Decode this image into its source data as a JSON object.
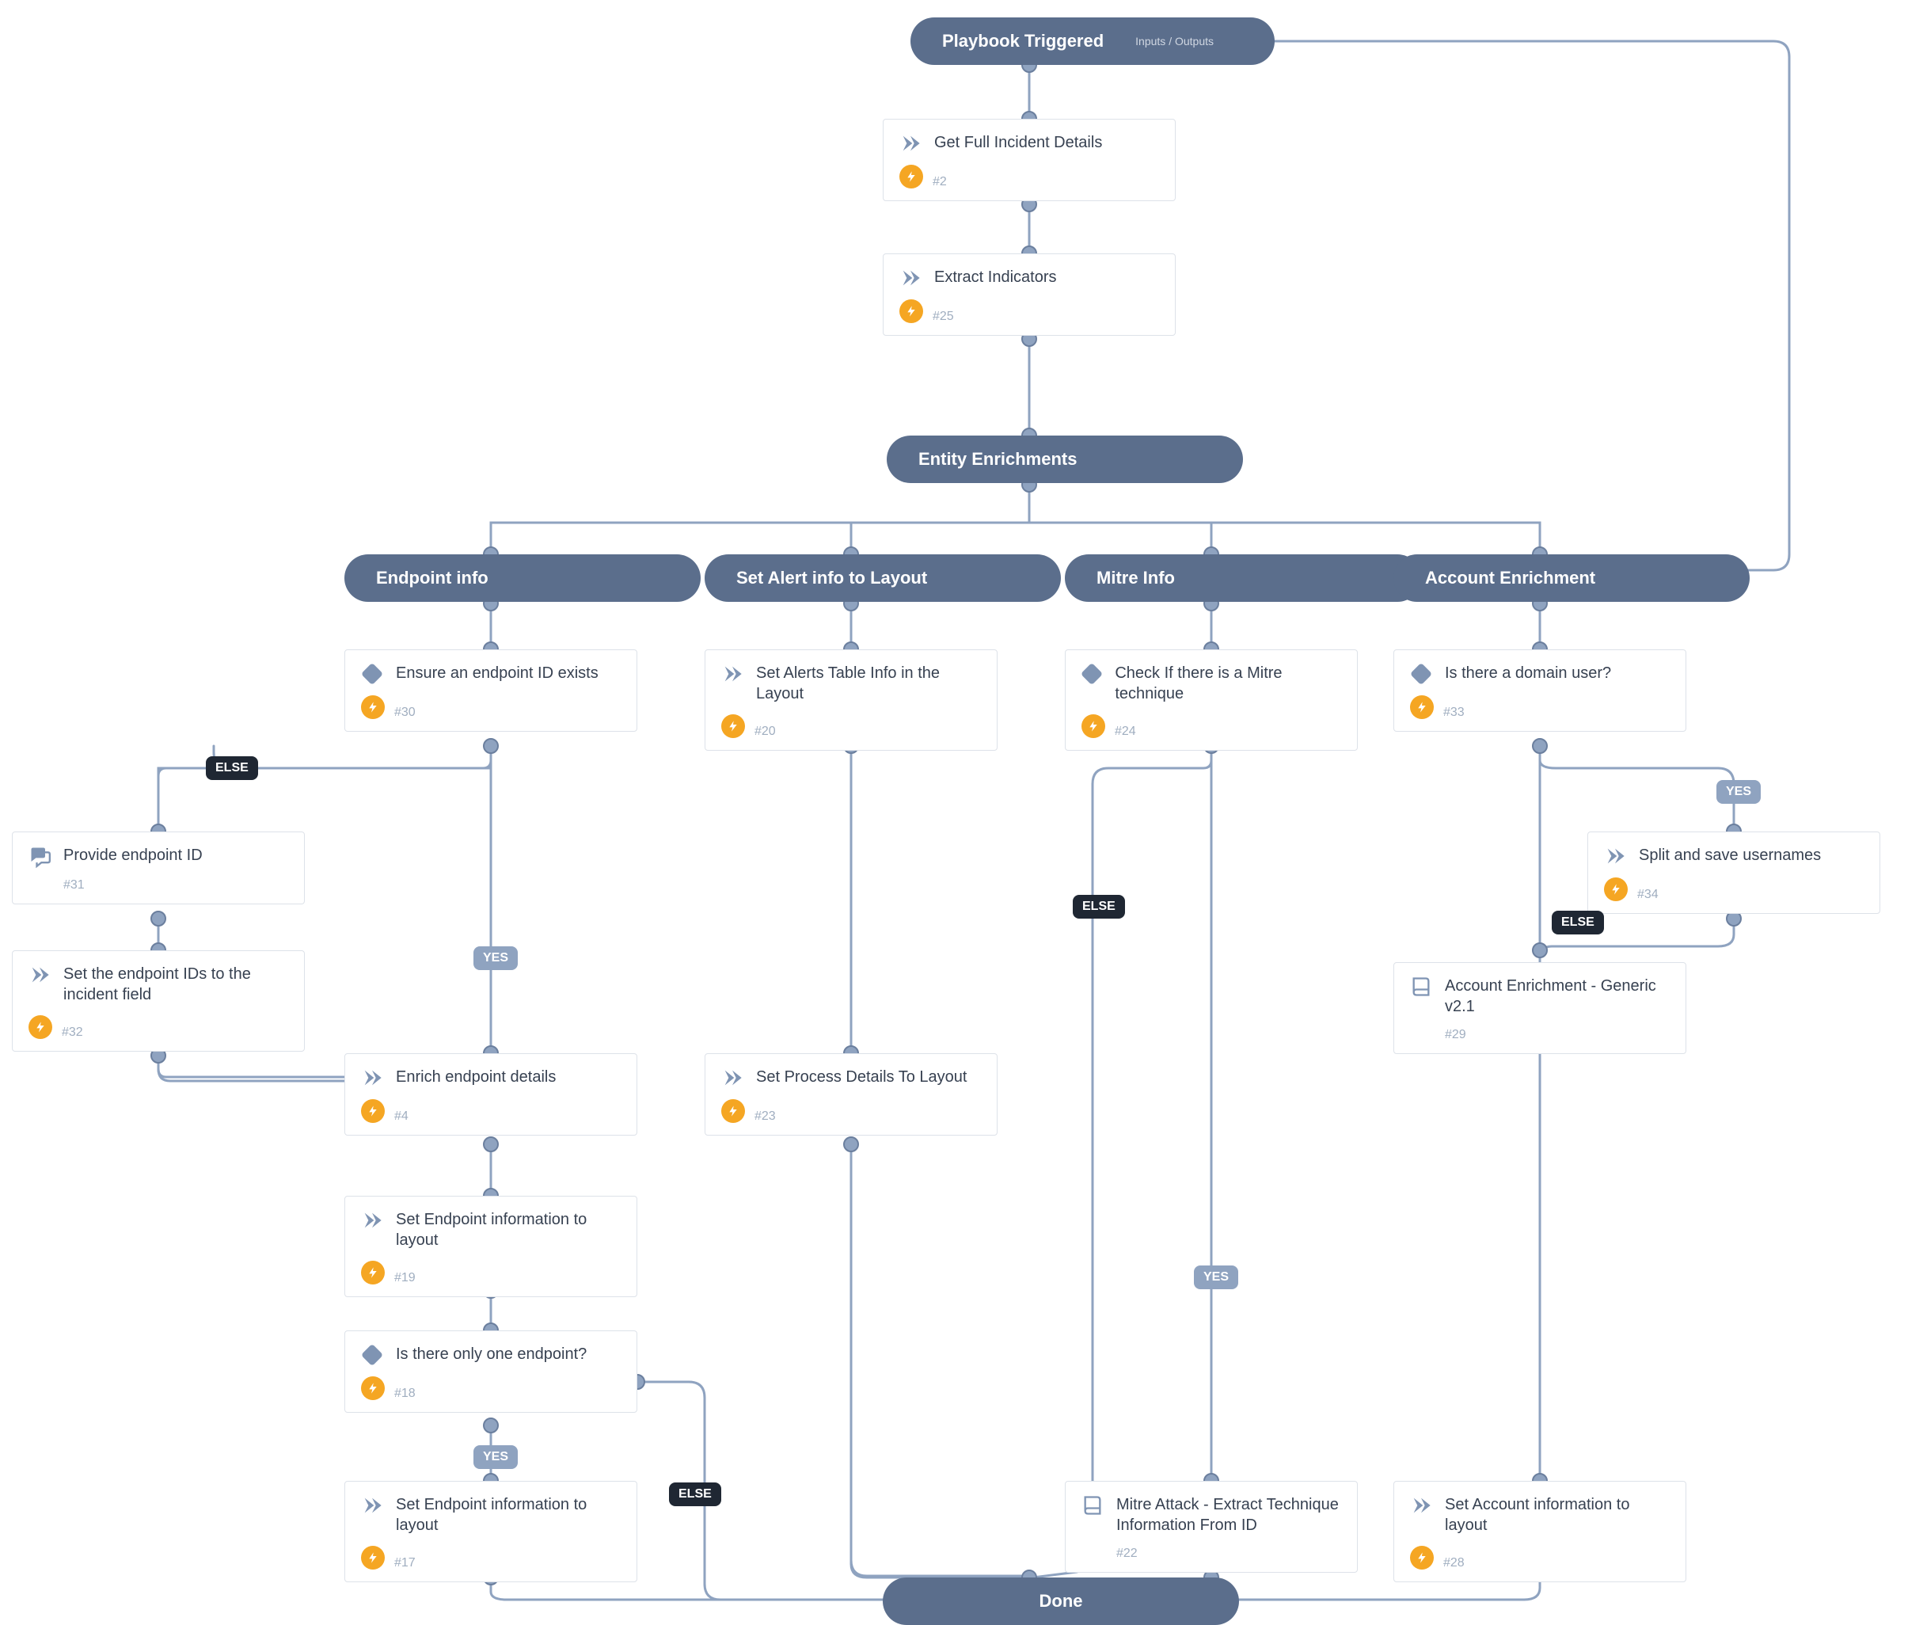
{
  "start": {
    "title": "Playbook Triggered",
    "sub": "Inputs / Outputs"
  },
  "sections": {
    "entity": "Entity Enrichments",
    "endpoint": "Endpoint info",
    "alert": "Set Alert info to Layout",
    "mitre": "Mitre Info",
    "account": "Account Enrichment",
    "done": "Done"
  },
  "nodes": {
    "n2": {
      "title": "Get Full Incident Details",
      "hash": "#2"
    },
    "n25": {
      "title": "Extract Indicators",
      "hash": "#25"
    },
    "n30": {
      "title": "Ensure an endpoint ID exists",
      "hash": "#30"
    },
    "n31": {
      "title": "Provide endpoint ID",
      "hash": "#31"
    },
    "n32": {
      "title": "Set the endpoint IDs to the incident field",
      "hash": "#32"
    },
    "n4": {
      "title": "Enrich endpoint details",
      "hash": "#4"
    },
    "n19": {
      "title": "Set Endpoint information to layout",
      "hash": "#19"
    },
    "n18": {
      "title": "Is there only one endpoint?",
      "hash": "#18"
    },
    "n17": {
      "title": "Set Endpoint information to layout",
      "hash": "#17"
    },
    "n20": {
      "title": "Set Alerts Table Info in the Layout",
      "hash": "#20"
    },
    "n23": {
      "title": "Set Process Details To Layout",
      "hash": "#23"
    },
    "n24": {
      "title": "Check If there is a Mitre technique",
      "hash": "#24"
    },
    "n22": {
      "title": "Mitre Attack - Extract Technique Information From ID",
      "hash": "#22"
    },
    "n33": {
      "title": "Is there a domain user?",
      "hash": "#33"
    },
    "n34": {
      "title": "Split and save usernames",
      "hash": "#34"
    },
    "n29": {
      "title": "Account Enrichment - Generic v2.1",
      "hash": "#29"
    },
    "n28": {
      "title": "Set Account information to layout",
      "hash": "#28"
    }
  },
  "badges": {
    "yes": "YES",
    "else": "ELSE"
  }
}
